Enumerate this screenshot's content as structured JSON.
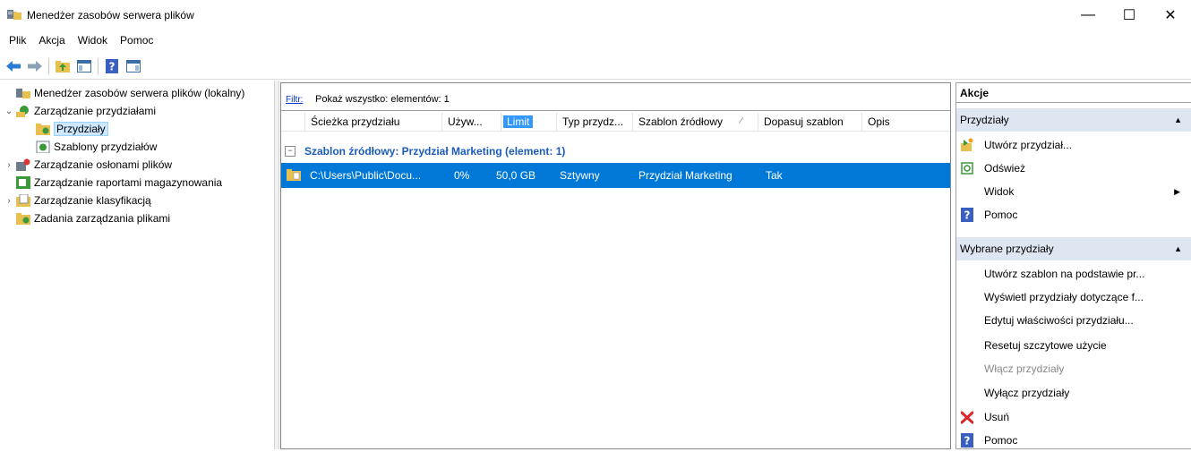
{
  "window": {
    "title": "Menedżer zasobów serwera plików",
    "minimize": "—",
    "maximize": "☐",
    "close": "✕"
  },
  "menu": {
    "items": [
      "Plik",
      "Akcja",
      "Widok",
      "Pomoc"
    ]
  },
  "toolbar": {
    "icons": [
      "back-arrow-icon",
      "forward-arrow-icon",
      "folder-up-icon",
      "show-hide-console-tree-icon",
      "help-icon",
      "show-hide-action-pane-icon"
    ]
  },
  "tree": {
    "root": "Menedżer zasobów serwera plików (lokalny)",
    "quota_mgmt": "Zarządzanie przydziałami",
    "quotas": "Przydziały",
    "quota_templates": "Szablony przydziałów",
    "screening": "Zarządzanie osłonami plików",
    "reports": "Zarządzanie raportami magazynowania",
    "classification": "Zarządzanie klasyfikacją",
    "file_tasks": "Zadania zarządzania plikami"
  },
  "center": {
    "filter_link": "Filtr:",
    "filter_text": "Pokaż wszystko: elementów: 1",
    "columns": [
      "Ścieżka przydziału",
      "Używ...",
      "Limit",
      "Typ przydz...",
      "Szablon źródłowy",
      "Dopasuj szablon",
      "Opis"
    ],
    "sort_glyph": "⁄",
    "group_toggle": "−",
    "group_label": "Szablon źródłowy: Przydział Marketing (element: 1)",
    "row": {
      "path": "C:\\Users\\Public\\Docu...",
      "used": "0%",
      "limit": "50,0 GB",
      "type": "Sztywny",
      "template": "Przydział Marketing",
      "match": "Tak"
    }
  },
  "actions": {
    "header": "Akcje",
    "section1": {
      "title": "Przydziały",
      "arrow": "▲"
    },
    "section1_items": {
      "create": "Utwórz przydział...",
      "refresh": "Odśwież",
      "view": "Widok",
      "view_arrow": "▶",
      "help": "Pomoc"
    },
    "section2": {
      "title": "Wybrane przydziały",
      "arrow": "▲"
    },
    "section2_items": {
      "create_template": "Utwórz szablon na podstawie pr...",
      "show_quotas": "Wyświetl przydziały dotyczące f...",
      "edit_props": "Edytuj właściwości przydziału...",
      "reset_peak": "Resetuj szczytowe użycie",
      "enable": "Włącz przydziały",
      "disable": "Wyłącz przydziały",
      "delete": "Usuń",
      "help": "Pomoc"
    }
  },
  "colors": {
    "selection": "#0078d7",
    "section_bg": "#dde6f1",
    "group_text": "#1a5cb8",
    "sorted_col": "#3399ff"
  }
}
